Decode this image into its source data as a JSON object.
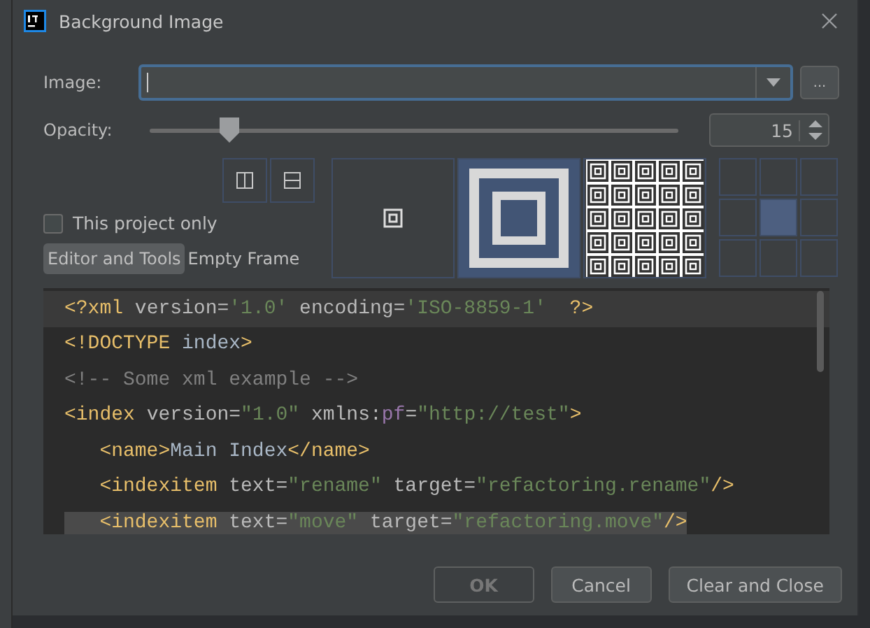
{
  "window": {
    "title": "Background Image"
  },
  "image": {
    "label": "Image:",
    "browse": "..."
  },
  "opacity": {
    "label": "Opacity:",
    "level": 0.15,
    "value": "15"
  },
  "flip_buttons": [
    {
      "kind": "vertical"
    },
    {
      "kind": "horizontal"
    }
  ],
  "this_project_only": {
    "label": "This project only",
    "checked": false
  },
  "tabs": [
    {
      "label": "Editor and Tools",
      "selected": true
    },
    {
      "label": "Empty Frame",
      "selected": false
    }
  ],
  "fill_modes": [
    {
      "kind": "center",
      "selected": false
    },
    {
      "kind": "scale",
      "selected": true
    },
    {
      "kind": "tile",
      "selected": false
    }
  ],
  "anchor": [
    {
      "selected": false
    },
    {
      "selected": false
    },
    {
      "selected": false
    },
    {
      "selected": false
    },
    {
      "selected": true
    },
    {
      "selected": false
    },
    {
      "selected": false
    },
    {
      "selected": false
    },
    {
      "selected": false
    }
  ],
  "preview_lines": [
    {
      "current": true,
      "selected": false,
      "tokens": [
        {
          "kind": "tag",
          "text": "<?xml"
        },
        {
          "kind": "attr",
          "text": " version="
        },
        {
          "kind": "value",
          "text": "'1.0'"
        },
        {
          "kind": "attr",
          "text": " encoding="
        },
        {
          "kind": "value",
          "text": "'ISO-8859-1'"
        },
        {
          "kind": "tag",
          "text": "  ?>"
        }
      ]
    },
    {
      "current": false,
      "selected": false,
      "tokens": [
        {
          "kind": "tag",
          "text": "<!DOCTYPE"
        },
        {
          "kind": "text",
          "text": " index"
        },
        {
          "kind": "tag",
          "text": ">"
        }
      ]
    },
    {
      "current": false,
      "selected": false,
      "tokens": [
        {
          "kind": "comment",
          "text": "<!-- Some xml example -->"
        }
      ]
    },
    {
      "current": false,
      "selected": false,
      "tokens": [
        {
          "kind": "tag",
          "text": "<index"
        },
        {
          "kind": "attr",
          "text": " version="
        },
        {
          "kind": "value",
          "text": "\"1.0\""
        },
        {
          "kind": "attr",
          "text": " xmlns:"
        },
        {
          "kind": "ns",
          "text": "pf"
        },
        {
          "kind": "attr",
          "text": "="
        },
        {
          "kind": "value",
          "text": "\"http://test\""
        },
        {
          "kind": "tag",
          "text": ">"
        }
      ]
    },
    {
      "current": false,
      "selected": false,
      "tokens": [
        {
          "kind": "tag",
          "text": "   <name>"
        },
        {
          "kind": "text",
          "text": "Main Index"
        },
        {
          "kind": "tag",
          "text": "</name>"
        }
      ]
    },
    {
      "current": false,
      "selected": false,
      "tokens": [
        {
          "kind": "tag",
          "text": "   <indexitem"
        },
        {
          "kind": "attr",
          "text": " text="
        },
        {
          "kind": "value",
          "text": "\"rename\""
        },
        {
          "kind": "attr",
          "text": " target="
        },
        {
          "kind": "value",
          "text": "\"refactoring.rename\""
        },
        {
          "kind": "tag",
          "text": "/>"
        }
      ]
    },
    {
      "current": false,
      "selected": true,
      "tokens": [
        {
          "kind": "tag",
          "text": "   <indexitem"
        },
        {
          "kind": "attr",
          "text": " text="
        },
        {
          "kind": "value",
          "text": "\"move\""
        },
        {
          "kind": "attr",
          "text": " target="
        },
        {
          "kind": "value",
          "text": "\"refactoring.move\""
        },
        {
          "kind": "tag",
          "text": "/>"
        }
      ]
    }
  ],
  "buttons": [
    {
      "label": "OK",
      "disabled": true
    },
    {
      "label": "Cancel",
      "disabled": false
    },
    {
      "label": "Clear and Close",
      "disabled": false
    }
  ]
}
